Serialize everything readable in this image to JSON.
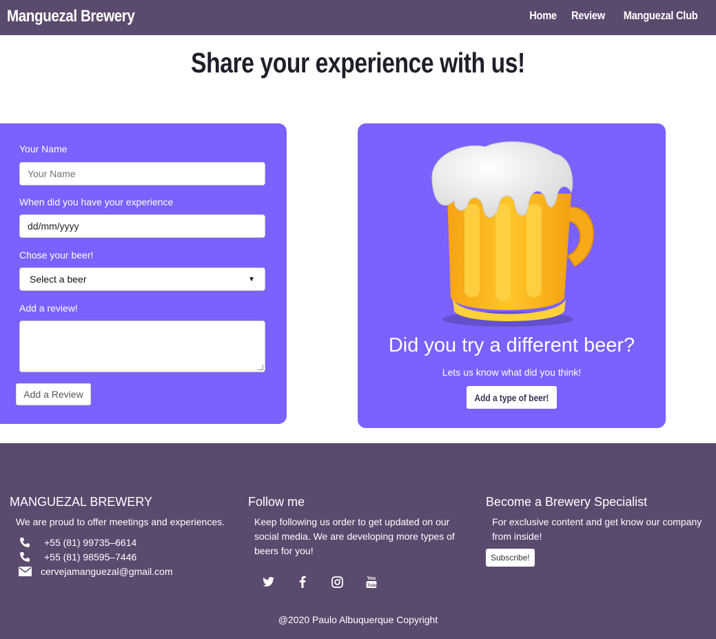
{
  "nav": {
    "brand": "Manguezal Brewery",
    "links": [
      "Home",
      "Review",
      "Manguezal Club"
    ]
  },
  "page": {
    "title": "Share your experience with us!"
  },
  "form": {
    "name_label": "Your Name",
    "name_placeholder": "Your Name",
    "date_label": "When did you have your experience",
    "date_value": "dd/mm/yyyy",
    "beer_label": "Chose your beer!",
    "beer_selected": "Select a beer",
    "review_label": "Add a review!",
    "submit_label": "Add a Review"
  },
  "beer_card": {
    "heading": "Did you try a different beer?",
    "text": "Lets us know what did you think!",
    "button_label": "Add a type of beer!"
  },
  "footer": {
    "about_heading": "MANGUEZAL BREWERY",
    "about_text": "We are proud to offer meetings and experiences.",
    "phone1": "+55 (81) 99735–6614",
    "phone2": "+55 (81) 98595–7446",
    "email": "cervejamanguezal@gmail.com",
    "follow_heading": "Follow me",
    "follow_text": "Keep following us order to get updated on our social media. We are developing more types of beers for you!",
    "specialist_heading": "Become a Brewery Specialist",
    "specialist_text": "For exclusive content and get know our company from inside!",
    "subscribe_label": "Subscribe!",
    "copyright": "@2020 Paulo Albuquerque Copyright",
    "social_icons": [
      "twitter-icon",
      "facebook-icon",
      "instagram-icon",
      "youtube-icon"
    ]
  },
  "colors": {
    "navbar": "#5a4a6e",
    "card": "#7b61ff",
    "footer": "#5a4a6e",
    "beer_gold": "#f9b91b",
    "foam": "#f2f2f2"
  }
}
